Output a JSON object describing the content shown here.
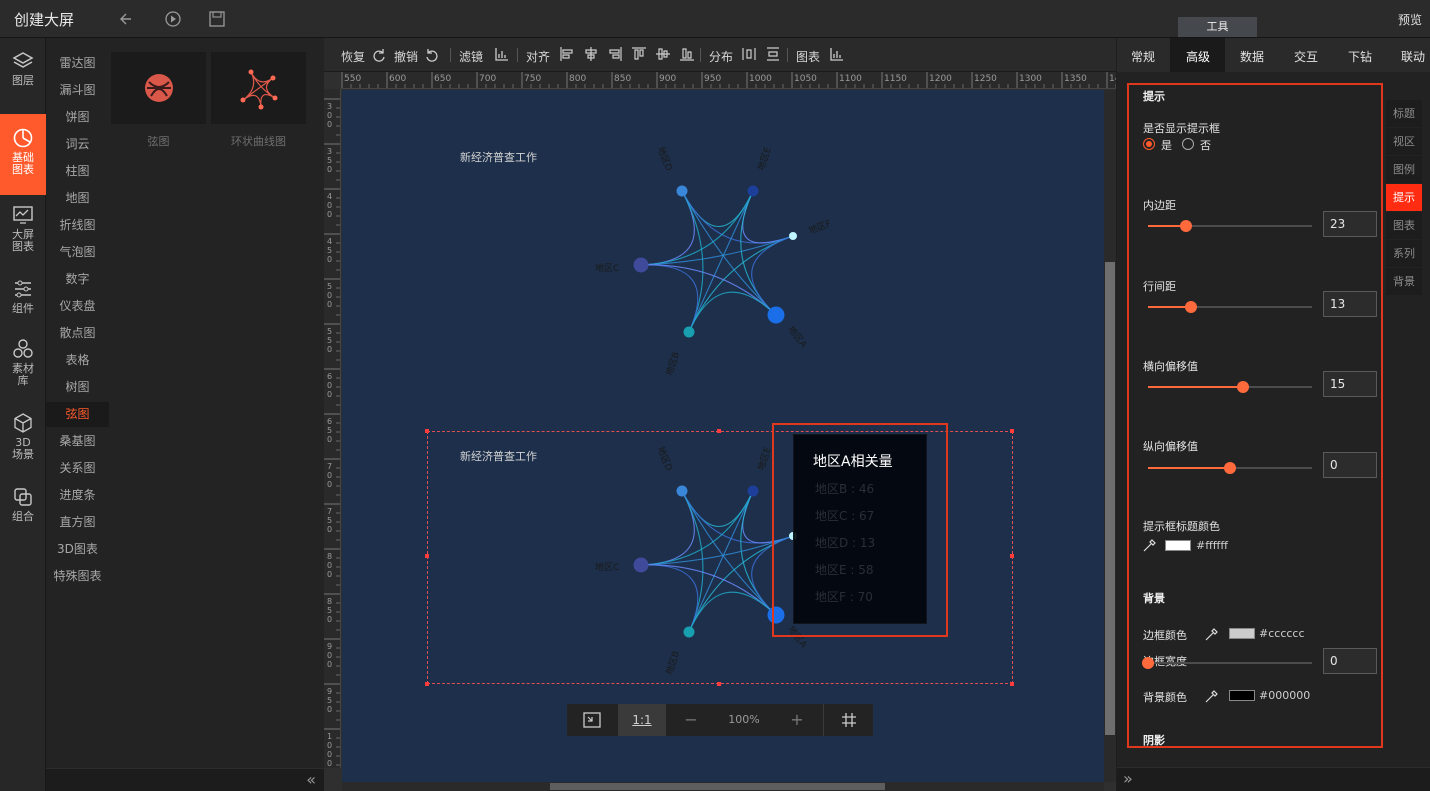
{
  "header": {
    "title": "创建大屏",
    "preview": "预览",
    "tools_tab": "工具"
  },
  "rail": [
    {
      "label": "图层",
      "icon": "layers-icon"
    },
    {
      "label": "基础\n图表",
      "icon": "pie-chart-icon",
      "active": true
    },
    {
      "label": "大屏\n图表",
      "icon": "dashboard-chart-icon"
    },
    {
      "label": "组件",
      "icon": "sliders-icon"
    },
    {
      "label": "素材\n库",
      "icon": "material-library-icon"
    },
    {
      "label": "3D\n场景",
      "icon": "cube-icon"
    },
    {
      "label": "组合",
      "icon": "group-icon"
    }
  ],
  "categories": [
    "雷达图",
    "漏斗图",
    "饼图",
    "词云",
    "柱图",
    "地图",
    "折线图",
    "气泡图",
    "数字",
    "仪表盘",
    "散点图",
    "表格",
    "树图",
    "弦图",
    "桑基图",
    "关系图",
    "进度条",
    "直方图",
    "3D图表",
    "特殊图表"
  ],
  "active_category": "弦图",
  "thumbs": [
    {
      "label": "弦图"
    },
    {
      "label": "环状曲线图"
    }
  ],
  "toolbar": {
    "redo": "恢复",
    "undo": "撤销",
    "filter": "滤镜",
    "align": "对齐",
    "distribute": "分布",
    "chart": "图表"
  },
  "ruler_h": [
    "550",
    "600",
    "650",
    "700",
    "750",
    "800",
    "850",
    "900",
    "950",
    "1000",
    "1050",
    "1100",
    "1150",
    "1200",
    "1250",
    "1300",
    "1350",
    "14"
  ],
  "ruler_v": [
    "300",
    "350",
    "400",
    "450",
    "500",
    "550",
    "600",
    "650",
    "700",
    "750",
    "800",
    "850",
    "900",
    "950",
    "1000",
    "100"
  ],
  "charts": [
    {
      "title": "新经济普查工作",
      "nodes": [
        "地区D",
        "地区E",
        "地区F",
        "地区C",
        "地区B",
        "地区A"
      ]
    },
    {
      "title": "新经济普查工作",
      "nodes": [
        "地区D",
        "地区E",
        "地区F",
        "地区C",
        "地区B",
        "地区A"
      ]
    }
  ],
  "tooltip": {
    "title": "地区A相关量",
    "rows": [
      "地区B : 46",
      "地区C : 67",
      "地区D : 13",
      "地区E : 58",
      "地区F : 70"
    ]
  },
  "zoom": {
    "ratio": "1:1",
    "minus": "−",
    "value": "100%",
    "plus": "+"
  },
  "right_tabs": [
    "常规",
    "高级",
    "数据",
    "交互",
    "下钻",
    "联动"
  ],
  "active_right_tab": "高级",
  "side_tabs": [
    "标题",
    "视区",
    "图例",
    "提示",
    "图表",
    "系列",
    "背景"
  ],
  "active_side_tab": "提示",
  "panel": {
    "section": "提示",
    "show_label": "是否显示提示框",
    "radio_yes": "是",
    "radio_no": "否",
    "show_tooltip": true,
    "padding_label": "内边距",
    "padding": "23",
    "padding_level": 0.23,
    "line_label": "行间距",
    "line": "13",
    "line_level": 0.26,
    "hoff_label": "横向偏移值",
    "hoff": "15",
    "hoff_level": 0.58,
    "voff_label": "纵向偏移值",
    "voff": "0",
    "voff_level": 0.5,
    "title_color_label": "提示框标题颜色",
    "title_color": "#ffffff",
    "bg_section": "背景",
    "border_color_label": "边框颜色",
    "border_color": "#cccccc",
    "border_width_label": "边框宽度",
    "border_width": "0",
    "border_width_level": 0,
    "bg_color_label": "背景颜色",
    "bg_color": "#000000",
    "shadow_section": "阴影"
  }
}
